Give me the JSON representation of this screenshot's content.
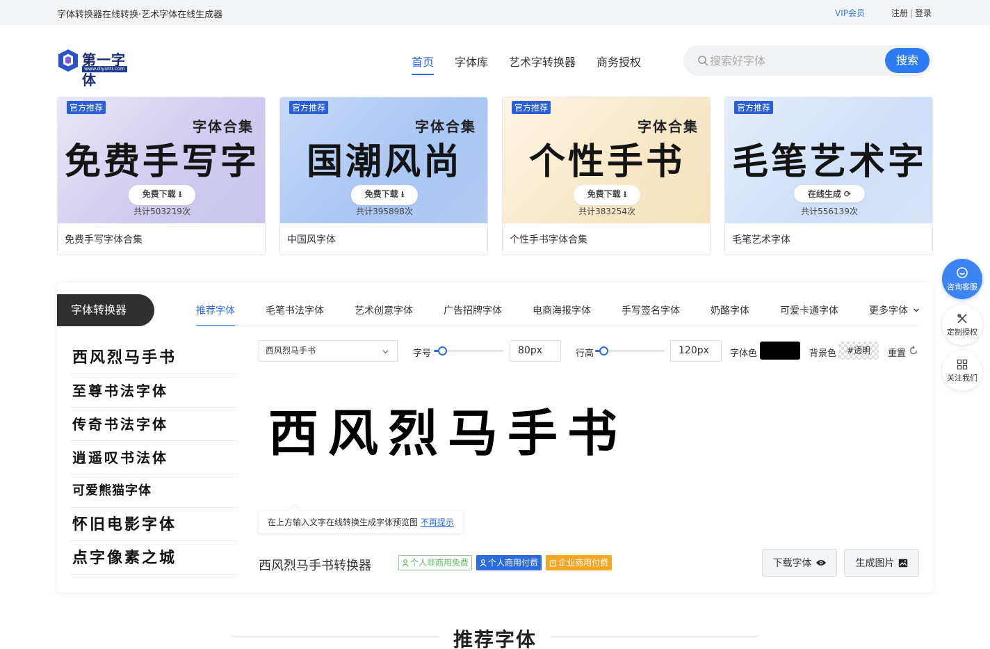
{
  "topbar": {
    "slogan": "字体转换器在线转换·艺术字体在线生成器",
    "vip": "VIP会员",
    "register": "注册",
    "separator": "|",
    "login": "登录"
  },
  "logo": {
    "name": "第一字体",
    "url": "www.diyiziti.com"
  },
  "nav": [
    {
      "label": "首页",
      "active": true
    },
    {
      "label": "字体库",
      "active": false
    },
    {
      "label": "艺术字转换器",
      "active": false
    },
    {
      "label": "商务授权",
      "active": false
    }
  ],
  "search": {
    "placeholder": "搜索好字体",
    "button": "搜索"
  },
  "banners": [
    {
      "tag": "官方推荐",
      "small": "字体合集",
      "big": "免费手写字",
      "button": "免费下载 ⭳",
      "count": "共计503219次",
      "caption": "免费手写字体合集"
    },
    {
      "tag": "官方推荐",
      "small": "字体合集",
      "big": "国潮风尚",
      "button": "免费下载 ⭳",
      "count": "共计395898次",
      "caption": "中国风字体"
    },
    {
      "tag": "官方推荐",
      "small": "字体合集",
      "big": "个性手书",
      "button": "免费下载 ⭳",
      "count": "共计383254次",
      "caption": "个性手书字体合集"
    },
    {
      "tag": "官方推荐",
      "small": "",
      "big": "毛笔艺术字",
      "button": "在线生成 ⟳",
      "count": "共计556139次",
      "caption": "毛笔艺术字体"
    }
  ],
  "converter": {
    "title": "字体转换器",
    "tabs": [
      "推荐字体",
      "毛笔书法字体",
      "艺术创意字体",
      "广告招牌字体",
      "电商海报字体",
      "手写签名字体",
      "奶酪字体",
      "可爱卡通字体",
      "更多字体"
    ],
    "font_list": [
      "西风烈马手书",
      "至尊书法字体",
      "传奇书法字体",
      "逍遥叹书法体",
      "可爱熊猫字体",
      "怀旧电影字体",
      "点字像素之城"
    ],
    "selected_font": "西风烈马手书",
    "size_label": "字号",
    "size_value": "80px",
    "size_level": 0.12,
    "line_label": "行高",
    "line_value": "120px",
    "line_level": 0.12,
    "color_label": "字体色",
    "color_value": "#000000",
    "bg_label": "背景色",
    "bg_value": "#透明",
    "reset_label": "重置",
    "preview_text": "西风烈马手书",
    "tip_text": "在上方输入文字在线转换生成字体预览图",
    "tip_link": "不再提示",
    "font_title": "西风烈马手书转换器",
    "badges": [
      "个人非商用免费",
      "个人商用付费",
      "企业商用付费"
    ],
    "download_btn": "下载字体",
    "image_btn": "生成图片"
  },
  "float": {
    "service": "咨询客服",
    "license": "定制授权",
    "follow": "关注我们"
  },
  "section": {
    "title": "推荐字体"
  }
}
